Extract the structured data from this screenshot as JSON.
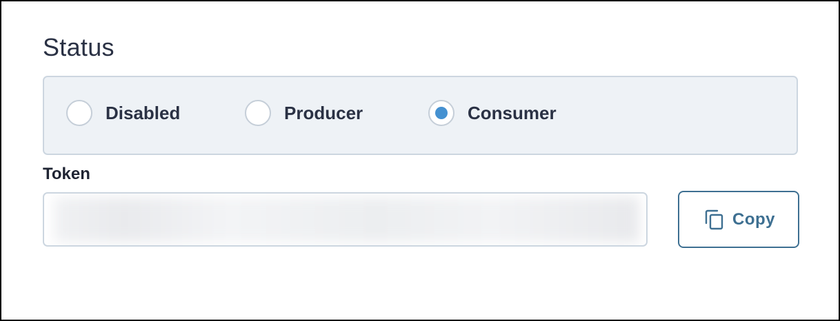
{
  "status": {
    "title": "Status",
    "options": [
      {
        "label": "Disabled",
        "selected": false
      },
      {
        "label": "Producer",
        "selected": false
      },
      {
        "label": "Consumer",
        "selected": true
      }
    ]
  },
  "token": {
    "label": "Token",
    "value": "",
    "copy_label": "Copy",
    "copy_icon": "copy-icon"
  },
  "colors": {
    "accent": "#4591d1",
    "button_border": "#3d6f91",
    "panel_background": "#eef2f6",
    "text_primary": "#2a3144"
  }
}
